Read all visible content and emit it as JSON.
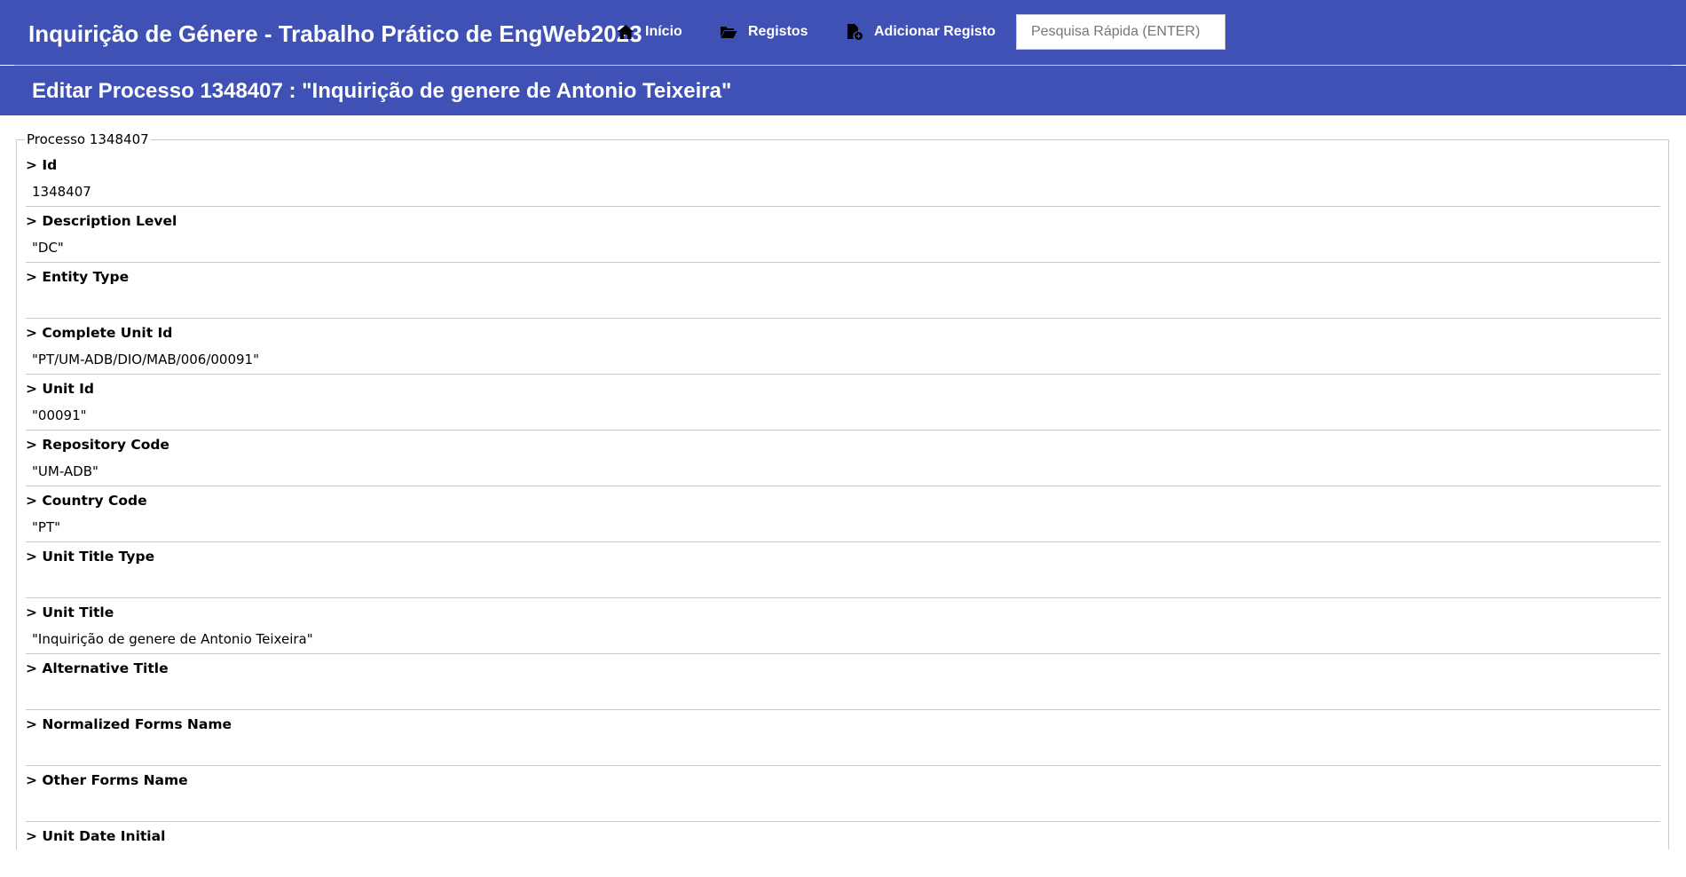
{
  "header": {
    "app_title": "Inquirição de Génere - Trabalho Prático de EngWeb2023",
    "nav": [
      {
        "label": "Início",
        "icon": "home-icon"
      },
      {
        "label": "Registos",
        "icon": "folder-open-icon"
      },
      {
        "label": "Adicionar Registo",
        "icon": "file-add-icon"
      }
    ],
    "search_placeholder": "Pesquisa Rápida (ENTER)",
    "background_color": "#3f51b5"
  },
  "page_title": "Editar Processo 1348407 : \"Inquirição de genere de Antonio Teixeira\"",
  "form": {
    "legend": "Processo 1348407",
    "fields": [
      {
        "label": "> Id",
        "value": "1348407"
      },
      {
        "label": "> Description Level",
        "value": "\"DC\""
      },
      {
        "label": "> Entity Type",
        "value": ""
      },
      {
        "label": "> Complete Unit Id",
        "value": "\"PT/UM-ADB/DIO/MAB/006/00091\""
      },
      {
        "label": "> Unit Id",
        "value": "\"00091\""
      },
      {
        "label": "> Repository Code",
        "value": "\"UM-ADB\""
      },
      {
        "label": "> Country Code",
        "value": "\"PT\""
      },
      {
        "label": "> Unit Title Type",
        "value": ""
      },
      {
        "label": "> Unit Title",
        "value": "\"Inquirição de genere de Antonio Teixeira\""
      },
      {
        "label": "> Alternative Title",
        "value": ""
      },
      {
        "label": "> Normalized Forms Name",
        "value": ""
      },
      {
        "label": "> Other Forms Name",
        "value": ""
      },
      {
        "label": "> Unit Date Initial",
        "value": ""
      }
    ]
  }
}
